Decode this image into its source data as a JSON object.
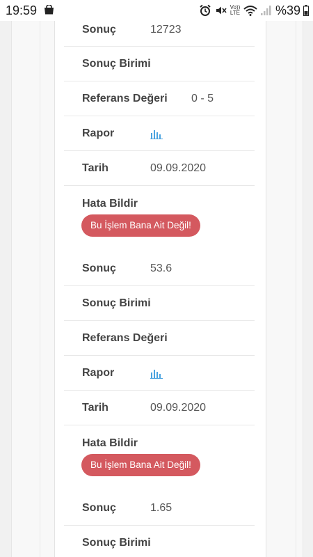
{
  "status_bar": {
    "time": "19:59",
    "volte_top": "Vo))",
    "volte_bottom": "LTE",
    "battery": "%39"
  },
  "labels": {
    "result": "Sonuç",
    "result_unit": "Sonuç Birimi",
    "reference": "Referans Değeri",
    "report": "Rapor",
    "date": "Tarih",
    "report_error": "Hata Bildir",
    "not_mine_button": "Bu İşlem Bana Ait Değil!"
  },
  "records": [
    {
      "result": "12723",
      "result_unit": "",
      "reference": "0 - 5",
      "report_icon": "bar-chart-icon",
      "date": "09.09.2020"
    },
    {
      "result": "53.6",
      "result_unit": "",
      "reference": "",
      "report_icon": "bar-chart-icon",
      "date": "09.09.2020"
    },
    {
      "result": "1.65",
      "result_unit": ""
    }
  ],
  "colors": {
    "button": "#d4595f",
    "chart_icon": "#4aa3df"
  }
}
